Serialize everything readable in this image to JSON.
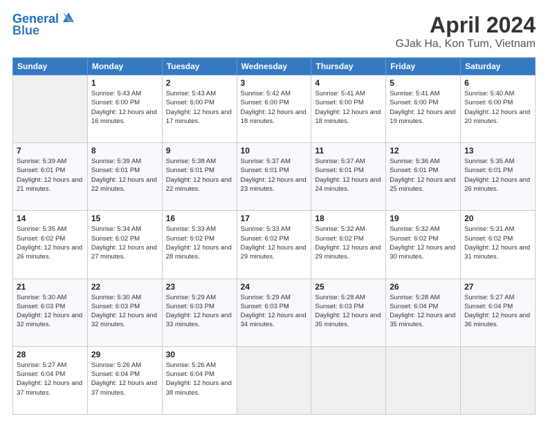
{
  "header": {
    "logo_line1": "General",
    "logo_line2": "Blue",
    "title": "April 2024",
    "subtitle": "GJak Ha, Kon Tum, Vietnam"
  },
  "weekdays": [
    "Sunday",
    "Monday",
    "Tuesday",
    "Wednesday",
    "Thursday",
    "Friday",
    "Saturday"
  ],
  "weeks": [
    [
      {
        "day": "",
        "sunrise": "",
        "sunset": "",
        "daylight": ""
      },
      {
        "day": "1",
        "sunrise": "Sunrise: 5:43 AM",
        "sunset": "Sunset: 6:00 PM",
        "daylight": "Daylight: 12 hours and 16 minutes."
      },
      {
        "day": "2",
        "sunrise": "Sunrise: 5:43 AM",
        "sunset": "Sunset: 6:00 PM",
        "daylight": "Daylight: 12 hours and 17 minutes."
      },
      {
        "day": "3",
        "sunrise": "Sunrise: 5:42 AM",
        "sunset": "Sunset: 6:00 PM",
        "daylight": "Daylight: 12 hours and 18 minutes."
      },
      {
        "day": "4",
        "sunrise": "Sunrise: 5:41 AM",
        "sunset": "Sunset: 6:00 PM",
        "daylight": "Daylight: 12 hours and 18 minutes."
      },
      {
        "day": "5",
        "sunrise": "Sunrise: 5:41 AM",
        "sunset": "Sunset: 6:00 PM",
        "daylight": "Daylight: 12 hours and 19 minutes."
      },
      {
        "day": "6",
        "sunrise": "Sunrise: 5:40 AM",
        "sunset": "Sunset: 6:00 PM",
        "daylight": "Daylight: 12 hours and 20 minutes."
      }
    ],
    [
      {
        "day": "7",
        "sunrise": "Sunrise: 5:39 AM",
        "sunset": "Sunset: 6:01 PM",
        "daylight": "Daylight: 12 hours and 21 minutes."
      },
      {
        "day": "8",
        "sunrise": "Sunrise: 5:39 AM",
        "sunset": "Sunset: 6:01 PM",
        "daylight": "Daylight: 12 hours and 22 minutes."
      },
      {
        "day": "9",
        "sunrise": "Sunrise: 5:38 AM",
        "sunset": "Sunset: 6:01 PM",
        "daylight": "Daylight: 12 hours and 22 minutes."
      },
      {
        "day": "10",
        "sunrise": "Sunrise: 5:37 AM",
        "sunset": "Sunset: 6:01 PM",
        "daylight": "Daylight: 12 hours and 23 minutes."
      },
      {
        "day": "11",
        "sunrise": "Sunrise: 5:37 AM",
        "sunset": "Sunset: 6:01 PM",
        "daylight": "Daylight: 12 hours and 24 minutes."
      },
      {
        "day": "12",
        "sunrise": "Sunrise: 5:36 AM",
        "sunset": "Sunset: 6:01 PM",
        "daylight": "Daylight: 12 hours and 25 minutes."
      },
      {
        "day": "13",
        "sunrise": "Sunrise: 5:35 AM",
        "sunset": "Sunset: 6:01 PM",
        "daylight": "Daylight: 12 hours and 26 minutes."
      }
    ],
    [
      {
        "day": "14",
        "sunrise": "Sunrise: 5:35 AM",
        "sunset": "Sunset: 6:02 PM",
        "daylight": "Daylight: 12 hours and 26 minutes."
      },
      {
        "day": "15",
        "sunrise": "Sunrise: 5:34 AM",
        "sunset": "Sunset: 6:02 PM",
        "daylight": "Daylight: 12 hours and 27 minutes."
      },
      {
        "day": "16",
        "sunrise": "Sunrise: 5:33 AM",
        "sunset": "Sunset: 6:02 PM",
        "daylight": "Daylight: 12 hours and 28 minutes."
      },
      {
        "day": "17",
        "sunrise": "Sunrise: 5:33 AM",
        "sunset": "Sunset: 6:02 PM",
        "daylight": "Daylight: 12 hours and 29 minutes."
      },
      {
        "day": "18",
        "sunrise": "Sunrise: 5:32 AM",
        "sunset": "Sunset: 6:02 PM",
        "daylight": "Daylight: 12 hours and 29 minutes."
      },
      {
        "day": "19",
        "sunrise": "Sunrise: 5:32 AM",
        "sunset": "Sunset: 6:02 PM",
        "daylight": "Daylight: 12 hours and 30 minutes."
      },
      {
        "day": "20",
        "sunrise": "Sunrise: 5:31 AM",
        "sunset": "Sunset: 6:02 PM",
        "daylight": "Daylight: 12 hours and 31 minutes."
      }
    ],
    [
      {
        "day": "21",
        "sunrise": "Sunrise: 5:30 AM",
        "sunset": "Sunset: 6:03 PM",
        "daylight": "Daylight: 12 hours and 32 minutes."
      },
      {
        "day": "22",
        "sunrise": "Sunrise: 5:30 AM",
        "sunset": "Sunset: 6:03 PM",
        "daylight": "Daylight: 12 hours and 32 minutes."
      },
      {
        "day": "23",
        "sunrise": "Sunrise: 5:29 AM",
        "sunset": "Sunset: 6:03 PM",
        "daylight": "Daylight: 12 hours and 33 minutes."
      },
      {
        "day": "24",
        "sunrise": "Sunrise: 5:29 AM",
        "sunset": "Sunset: 6:03 PM",
        "daylight": "Daylight: 12 hours and 34 minutes."
      },
      {
        "day": "25",
        "sunrise": "Sunrise: 5:28 AM",
        "sunset": "Sunset: 6:03 PM",
        "daylight": "Daylight: 12 hours and 35 minutes."
      },
      {
        "day": "26",
        "sunrise": "Sunrise: 5:28 AM",
        "sunset": "Sunset: 6:04 PM",
        "daylight": "Daylight: 12 hours and 35 minutes."
      },
      {
        "day": "27",
        "sunrise": "Sunrise: 5:27 AM",
        "sunset": "Sunset: 6:04 PM",
        "daylight": "Daylight: 12 hours and 36 minutes."
      }
    ],
    [
      {
        "day": "28",
        "sunrise": "Sunrise: 5:27 AM",
        "sunset": "Sunset: 6:04 PM",
        "daylight": "Daylight: 12 hours and 37 minutes."
      },
      {
        "day": "29",
        "sunrise": "Sunrise: 5:26 AM",
        "sunset": "Sunset: 6:04 PM",
        "daylight": "Daylight: 12 hours and 37 minutes."
      },
      {
        "day": "30",
        "sunrise": "Sunrise: 5:26 AM",
        "sunset": "Sunset: 6:04 PM",
        "daylight": "Daylight: 12 hours and 38 minutes."
      },
      {
        "day": "",
        "sunrise": "",
        "sunset": "",
        "daylight": ""
      },
      {
        "day": "",
        "sunrise": "",
        "sunset": "",
        "daylight": ""
      },
      {
        "day": "",
        "sunrise": "",
        "sunset": "",
        "daylight": ""
      },
      {
        "day": "",
        "sunrise": "",
        "sunset": "",
        "daylight": ""
      }
    ]
  ]
}
